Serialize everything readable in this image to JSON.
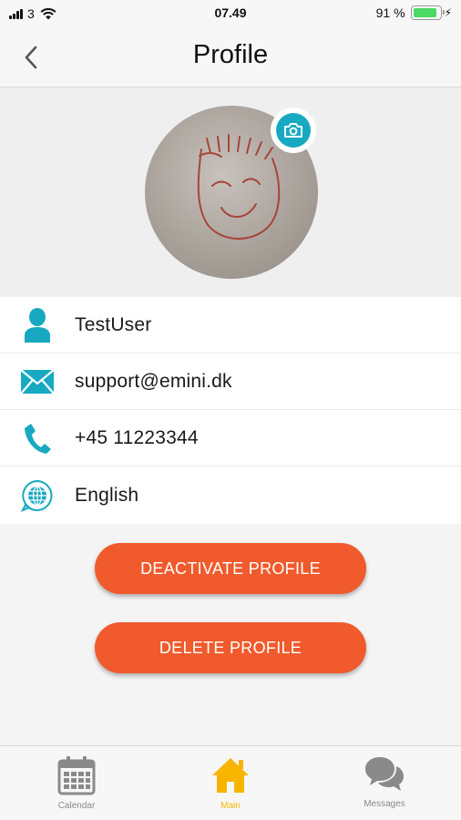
{
  "status_bar": {
    "carrier": "3",
    "time": "07.49",
    "battery_text": "91 %",
    "battery_level": 0.91
  },
  "nav": {
    "title": "Profile",
    "back_icon": "chevron-left-icon"
  },
  "profile": {
    "avatar_icon": "avatar-drawing",
    "camera_icon": "camera-icon"
  },
  "info": {
    "username": "TestUser",
    "email": "support@emini.dk",
    "phone": "+45 11223344",
    "language": "English"
  },
  "actions": {
    "deactivate_label": "DEACTIVATE PROFILE",
    "delete_label": "DELETE PROFILE"
  },
  "tabs": [
    {
      "label": "Calendar",
      "icon": "calendar-icon",
      "active": false
    },
    {
      "label": "Main",
      "icon": "home-icon",
      "active": true
    },
    {
      "label": "Messages",
      "icon": "chat-bubbles-icon",
      "active": false
    }
  ],
  "colors": {
    "accent_teal": "#17a9c1",
    "button_orange": "#f05a2c",
    "active_tab": "#f7b500",
    "inactive_tab": "#8a8a8a"
  }
}
